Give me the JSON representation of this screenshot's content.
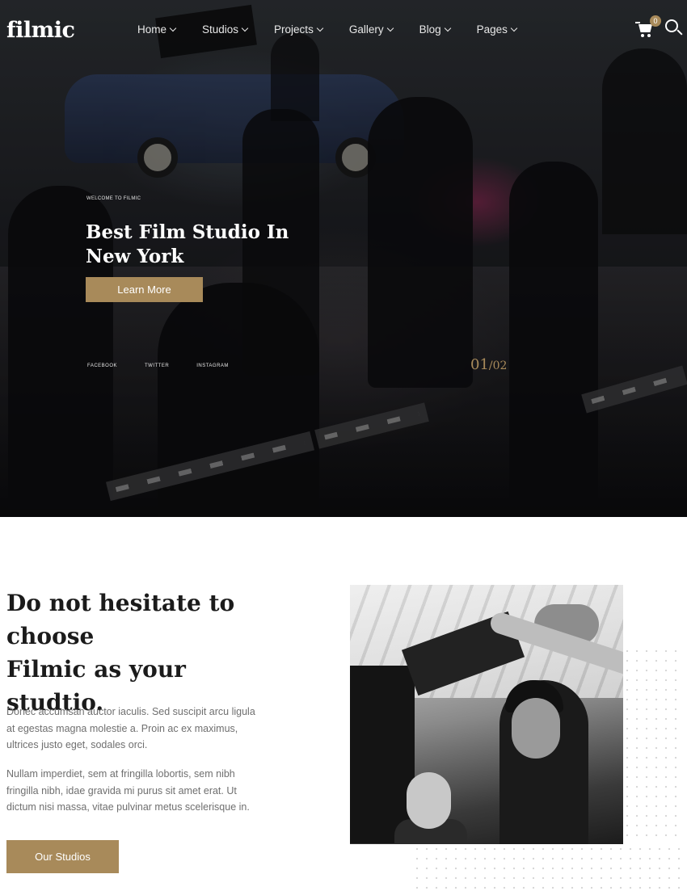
{
  "brand": {
    "logo": "filmic"
  },
  "nav": {
    "items": [
      {
        "label": "Home"
      },
      {
        "label": "Studios"
      },
      {
        "label": "Projects"
      },
      {
        "label": "Gallery"
      },
      {
        "label": "Blog"
      },
      {
        "label": "Pages"
      }
    ],
    "cart_count": "0"
  },
  "hero": {
    "eyebrow": "WELCOME TO FILMIC",
    "title": "Best Film Studio In New York",
    "cta": "Learn More",
    "socials": [
      "FACEBOOK",
      "TWITTER",
      "INSTAGRAM"
    ],
    "slide_current": "01",
    "slide_separator": "/",
    "slide_total": "02"
  },
  "about": {
    "heading_line1": "Do not hesitate to",
    "heading_line2": "choose",
    "heading_line3": "Filmic as your studtio.",
    "paragraph1": "Donec accumsan auctor iaculis. Sed suscipit arcu ligula at egestas magna molestie a. Proin ac ex maximus, ultrices justo eget, sodales orci.",
    "paragraph2": "Nullam imperdiet, sem at fringilla lobortis, sem nibh fringilla nibh, idae gravida mi purus sit amet erat. Ut dictum nisi massa, vitae pulvinar metus scelerisque in.",
    "cta": "Our Studios"
  },
  "colors": {
    "accent": "#a88a5a",
    "heading": "#1b1b1b",
    "body_text": "#6f6f6f"
  }
}
